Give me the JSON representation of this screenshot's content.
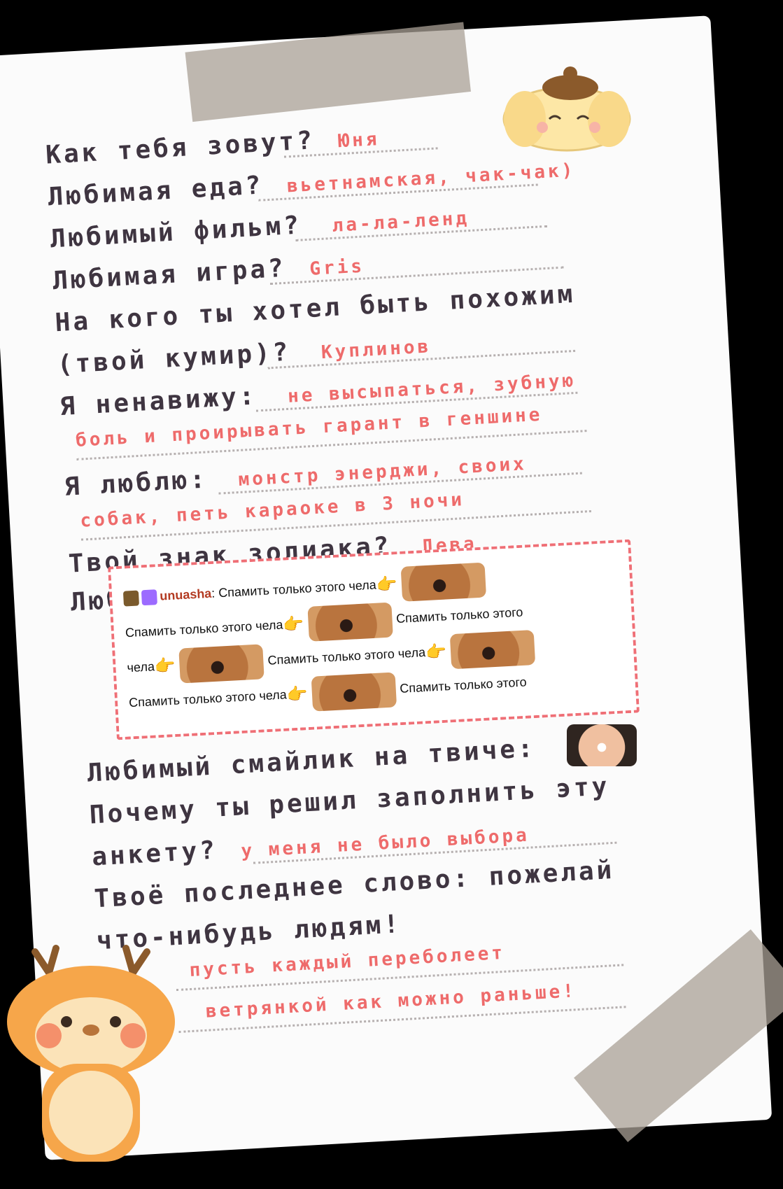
{
  "questions": [
    {
      "q": "Как тебя зовут?",
      "a": "Юня"
    },
    {
      "q": "Любимая еда?",
      "a": "вьетнамская, чак-чак)"
    },
    {
      "q": "Любимый фильм?",
      "a": "ла-ла-ленд"
    },
    {
      "q": "Любимая игра?",
      "a": "Gris"
    },
    {
      "q": "На кого ты хотел быть похожим",
      "a": ""
    },
    {
      "q": "(твой кумир)?",
      "a": "Куплинов"
    },
    {
      "q": "Я ненавижу:",
      "a": "не высыпаться, зубную"
    },
    {
      "q": "",
      "a": "боль и проирывать гарант в геншине"
    },
    {
      "q": "Я люблю:",
      "a": "монстр энерджи, своих"
    },
    {
      "q": "",
      "a": "собак, петь караоке в 3 ночи"
    },
    {
      "q": "Твой знак зодиака?",
      "a": "Дева"
    },
    {
      "q": "Любимая паста:",
      "a": ""
    },
    {
      "q": "Любимый смайлик на твиче:",
      "a": ""
    },
    {
      "q": "Почему ты решил заполнить эту",
      "a": ""
    },
    {
      "q": "анкету?",
      "a": "у меня не было выбора"
    },
    {
      "q": "Твоё последнее слово: пожелай",
      "a": ""
    },
    {
      "q": "что-нибудь людям!",
      "a": ""
    },
    {
      "q": "",
      "a": "пусть каждый переболеет"
    },
    {
      "q": "",
      "a": "ветрянкой как можно раньше!"
    }
  ],
  "paste": {
    "username": "unuasha",
    "colon": ":",
    "message": "Спамить только этого чела",
    "message_short": "Спамить только этого",
    "message_end": "чела"
  },
  "icons": {
    "hand": "pointing-right-hand-icon",
    "dog": "dog-emote-icon",
    "face": "smiling-face-emote-icon"
  }
}
